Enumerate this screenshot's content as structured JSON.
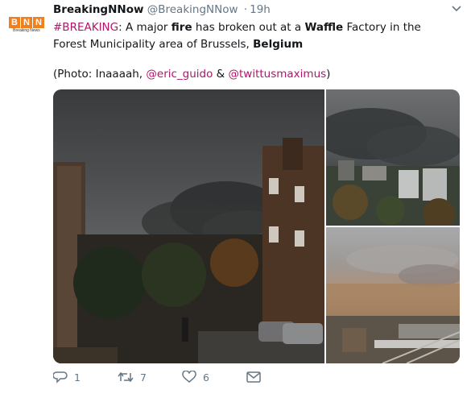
{
  "account": {
    "avatar_text": [
      "B",
      "N",
      "N"
    ],
    "avatar_subtitle": "Breaking News",
    "name": "BreakingNNow",
    "handle": "@BreakingNNow",
    "separator": "·",
    "time": "19h"
  },
  "tweet": {
    "hashtag": "#BREAKING",
    "part1": ": A major ",
    "bold1": "fire",
    "part2": " has broken out at a ",
    "bold2": "Waffle",
    "part3": " Factory in the Forest Municipality area of Brussels, ",
    "bold3": "Belgium",
    "credit_prefix": "(Photo: Inaaaah, ",
    "mention1": "@eric_guido",
    "credit_and": " & ",
    "mention2": "@twittusmaximus",
    "credit_suffix": ")"
  },
  "actions": {
    "reply_count": "1",
    "retweet_count": "7",
    "like_count": "6"
  },
  "icons": {
    "caret": "chevron-down-icon",
    "reply": "reply-icon",
    "retweet": "retweet-icon",
    "like": "heart-icon",
    "dm": "envelope-icon"
  },
  "colors": {
    "mention": "#b0156b",
    "secondary_text": "#657786",
    "avatar_orange": "#f07f1d"
  }
}
